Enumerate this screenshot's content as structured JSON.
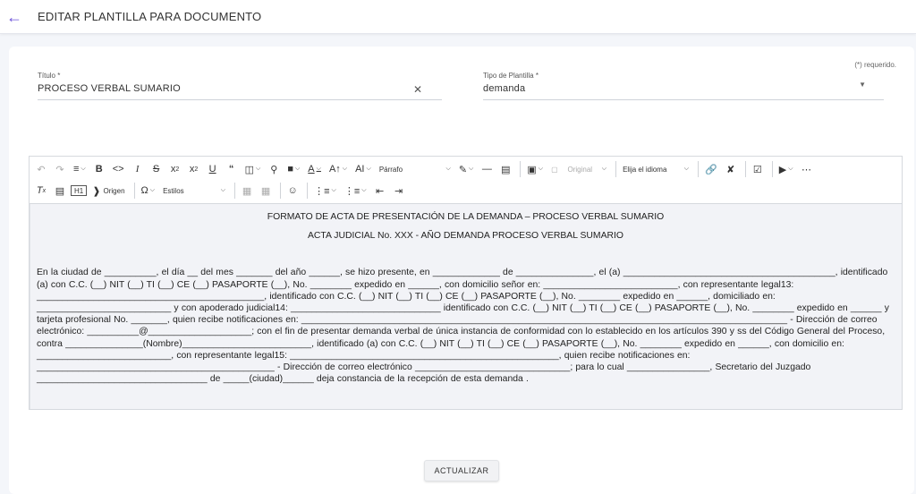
{
  "header": {
    "back_icon": "arrow-left-icon",
    "title": "EDITAR PLANTILLA PARA DOCUMENTO"
  },
  "form": {
    "required_note": "(*) requerido.",
    "titulo": {
      "label": "Título *",
      "value": "PROCESO VERBAL SUMARIO"
    },
    "tipo": {
      "label": "Tipo de Plantilla *",
      "value": "demanda"
    }
  },
  "toolbar": {
    "paragraph_label": "Párrafo",
    "original_label": "Original",
    "language_label": "Elija el idioma",
    "source_label": "Origen",
    "styles_label": "Estilos"
  },
  "document": {
    "heading1": "FORMATO DE ACTA DE PRESENTACIÓN DE LA DEMANDA – PROCESO VERBAL SUMARIO",
    "heading2": "ACTA JUDICIAL No. XXX - AÑO DEMANDA PROCESO VERBAL SUMARIO",
    "body": "En la ciudad de __________, el día __ del mes _______ del año ______, se hizo presente, en _____________ de _______________, el (a) _________________________________________, identificado (a) con C.C. (__) NIT (__)  TI (__)  CE (__) PASAPORTE (__), No. ________ expedido en ______, con domicilio señor en: __________________________, con representante legal13: ____________________________________________, identificado con C.C. (__) NIT (__)  TI (__)  CE (__) PASAPORTE (__), No. ________ expedido en ______, domiciliado en: __________________________ y con apoderado judicial14: _____________________________ identificado con C.C. (__) NIT (__)  TI (__)  CE (__) PASAPORTE (__), No. ________ expedido en ______  y tarjeta profesional No. _______, quien recibe notificaciones en: ______________________________________________________________________________________________ - Dirección de correo electrónico: __________@____________________; con el fin de presentar demanda verbal de única instancia de conformidad con lo establecido en los artículos 390 y ss del Código General del Proceso, contra _______________(Nombre)_________________________, identificado (a) con C.C. (__) NIT (__)  TI (__)  CE (__) PASAPORTE (__), No. ________ expedido en ______, con domicilio en: __________________________, con representante legal15: ____________________________________________________, quien recibe notificaciones en: ______________________________________________ - Dirección de correo electrónico ______________________________; para lo cual ________________, Secretario del Juzgado _________________________________ de _____(ciudad)______ deja constancia de la recepción de esta demanda ."
  },
  "actions": {
    "update_label": "ACTUALIZAR"
  },
  "colors": {
    "accent": "#6b52d9",
    "editor_bg": "#f2f3f7"
  }
}
